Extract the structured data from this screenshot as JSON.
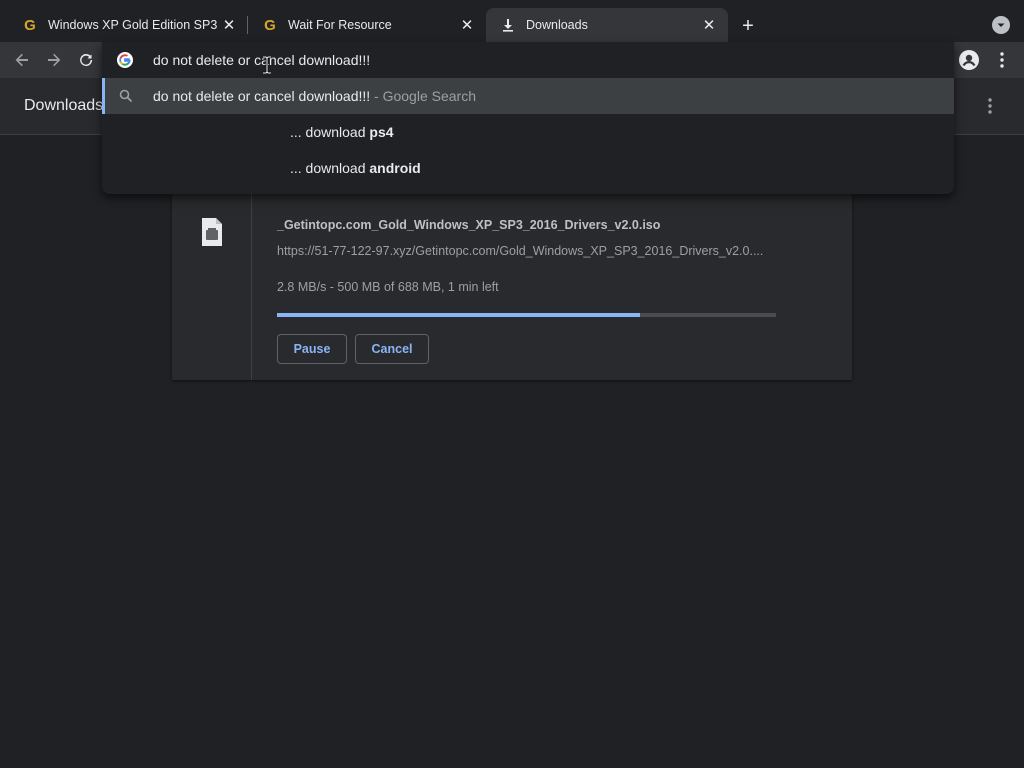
{
  "tabs": [
    {
      "title": "Windows XP Gold Edition SP3",
      "favicon": "g-favicon-icon"
    },
    {
      "title": "Wait For Resource",
      "favicon": "g-favicon-icon"
    },
    {
      "title": "Downloads",
      "favicon": "download-icon"
    }
  ],
  "omnibox": {
    "query": "do not delete or cancel download!!!",
    "suggestions": [
      {
        "text": "do not delete or cancel download!!!",
        "suffix": " - Google Search",
        "icon": "search-icon"
      },
      {
        "prefix": "... download ",
        "bold": "ps4"
      },
      {
        "prefix": "... download ",
        "bold": "android"
      }
    ]
  },
  "page": {
    "title": "Downloads"
  },
  "download": {
    "file_name": "_Getintopc.com_Gold_Windows_XP_SP3_2016_Drivers_v2.0.iso",
    "url": "https://51-77-122-97.xyz/Getintopc.com/Gold_Windows_XP_SP3_2016_Drivers_v2.0....",
    "status": "2.8 MB/s - 500 MB of 688 MB, 1 min left",
    "progress": 0.727,
    "pause_label": "Pause",
    "cancel_label": "Cancel"
  },
  "colors": {
    "accent": "#8ab4f8",
    "background": "#202124",
    "surface": "#292a2d",
    "toolbar": "#35363a"
  }
}
